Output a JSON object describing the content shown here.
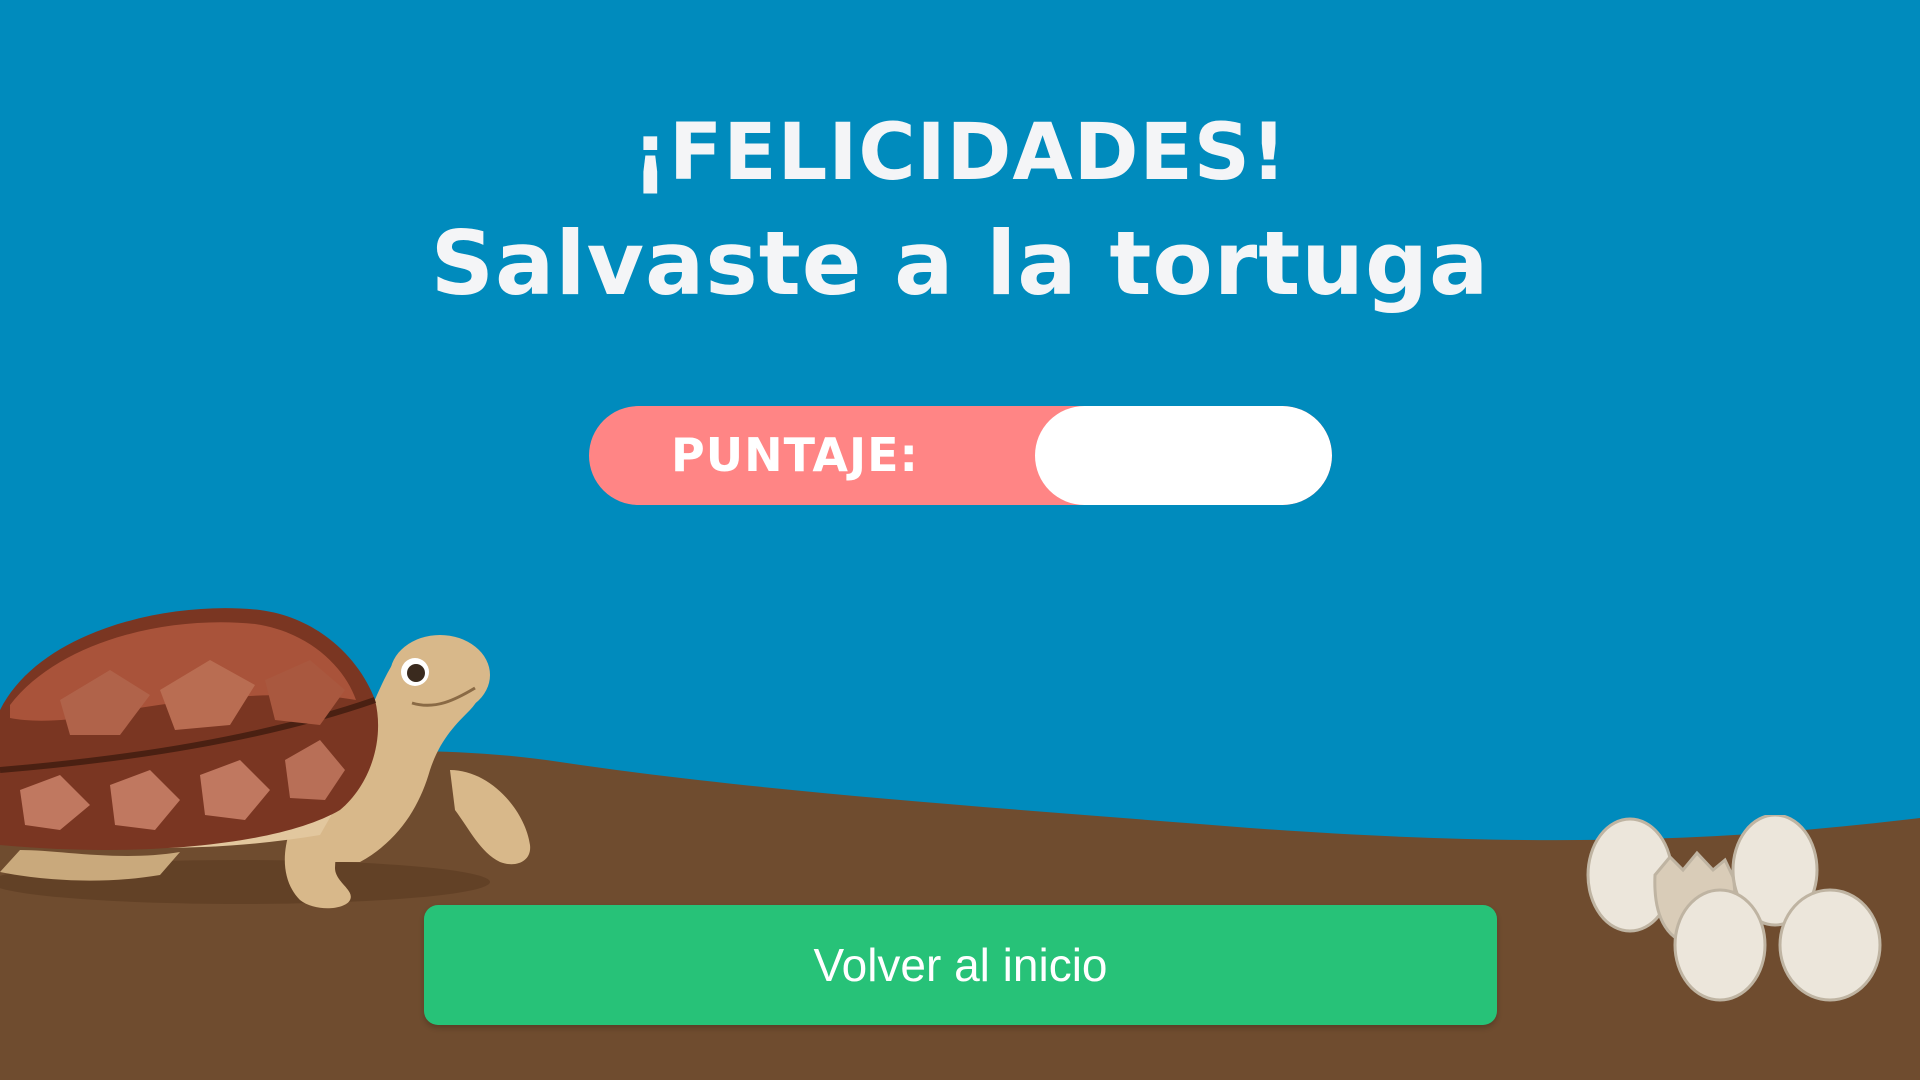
{
  "title": {
    "line1": "¡FELICIDADES!",
    "line2": "Salvaste a la tortuga"
  },
  "score": {
    "label": "PUNTAJE:",
    "value": ""
  },
  "buttons": {
    "home_label": "Volver al inicio"
  },
  "colors": {
    "sky": "#008bbd",
    "ground": "#6f4c2f",
    "title_text": "#f4f5f7",
    "score_bar": "#ff8585",
    "score_value_bg": "#ffffff",
    "button": "#27c278",
    "button_text": "#ffffff"
  },
  "illustrations": [
    "turtle",
    "turtle-eggs"
  ]
}
